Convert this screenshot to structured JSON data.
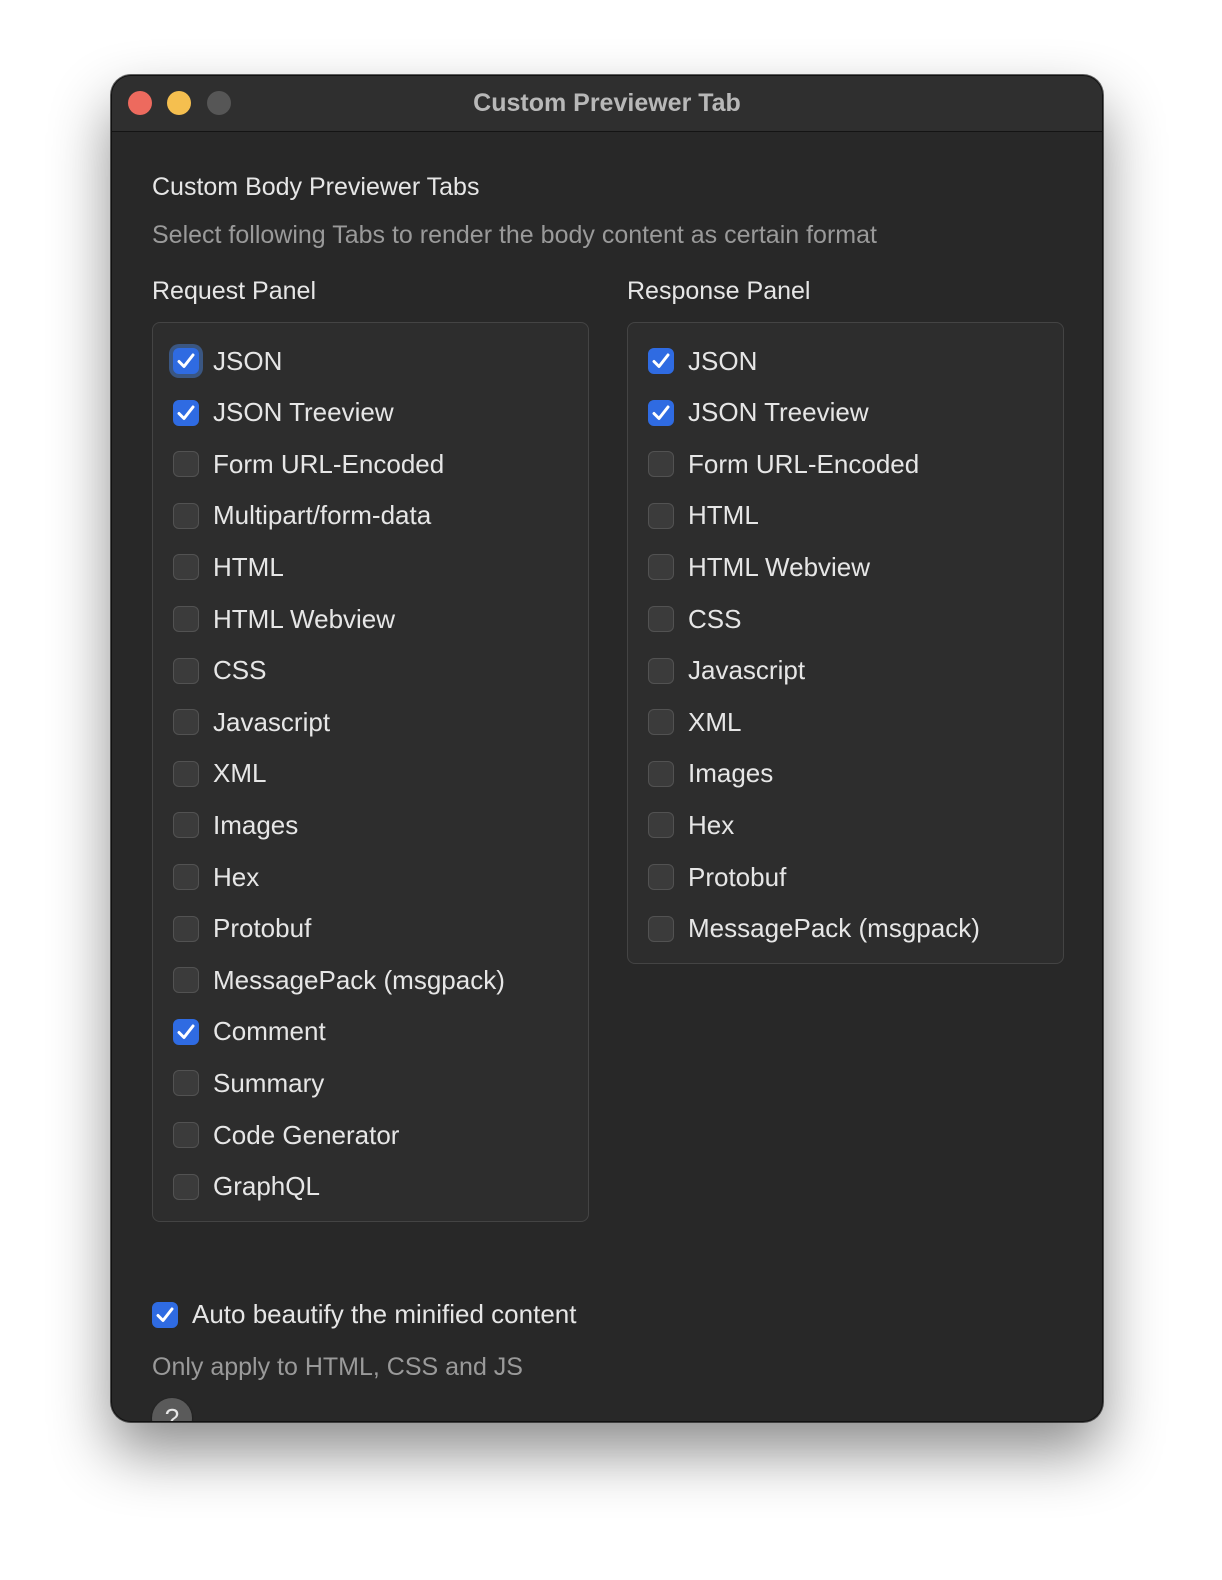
{
  "window": {
    "title": "Custom Previewer Tab"
  },
  "header": {
    "title": "Custom Body Previewer Tabs",
    "subtitle": "Select following Tabs to render the body content as certain format"
  },
  "request_panel": {
    "label": "Request Panel",
    "items": [
      {
        "label": "JSON",
        "checked": true,
        "focused": true
      },
      {
        "label": "JSON Treeview",
        "checked": true
      },
      {
        "label": "Form URL-Encoded",
        "checked": false
      },
      {
        "label": "Multipart/form-data",
        "checked": false
      },
      {
        "label": "HTML",
        "checked": false
      },
      {
        "label": "HTML Webview",
        "checked": false
      },
      {
        "label": "CSS",
        "checked": false
      },
      {
        "label": "Javascript",
        "checked": false
      },
      {
        "label": "XML",
        "checked": false
      },
      {
        "label": "Images",
        "checked": false
      },
      {
        "label": "Hex",
        "checked": false
      },
      {
        "label": "Protobuf",
        "checked": false
      },
      {
        "label": "MessagePack (msgpack)",
        "checked": false
      },
      {
        "label": "Comment",
        "checked": true
      },
      {
        "label": "Summary",
        "checked": false
      },
      {
        "label": "Code Generator",
        "checked": false
      },
      {
        "label": "GraphQL",
        "checked": false
      }
    ]
  },
  "response_panel": {
    "label": "Response Panel",
    "items": [
      {
        "label": "JSON",
        "checked": true
      },
      {
        "label": "JSON Treeview",
        "checked": true
      },
      {
        "label": "Form URL-Encoded",
        "checked": false
      },
      {
        "label": "HTML",
        "checked": false
      },
      {
        "label": "HTML Webview",
        "checked": false
      },
      {
        "label": "CSS",
        "checked": false
      },
      {
        "label": "Javascript",
        "checked": false
      },
      {
        "label": "XML",
        "checked": false
      },
      {
        "label": "Images",
        "checked": false
      },
      {
        "label": "Hex",
        "checked": false
      },
      {
        "label": "Protobuf",
        "checked": false
      },
      {
        "label": "MessagePack (msgpack)",
        "checked": false
      }
    ]
  },
  "auto_beautify": {
    "label": "Auto beautify the minified content",
    "checked": true,
    "note": "Only apply to HTML, CSS and JS"
  },
  "help": {
    "label": "?"
  },
  "colors": {
    "accent": "#2f6be2",
    "close": "#ed6a5e",
    "minimize": "#f5bf4f",
    "maximize": "#565656"
  }
}
